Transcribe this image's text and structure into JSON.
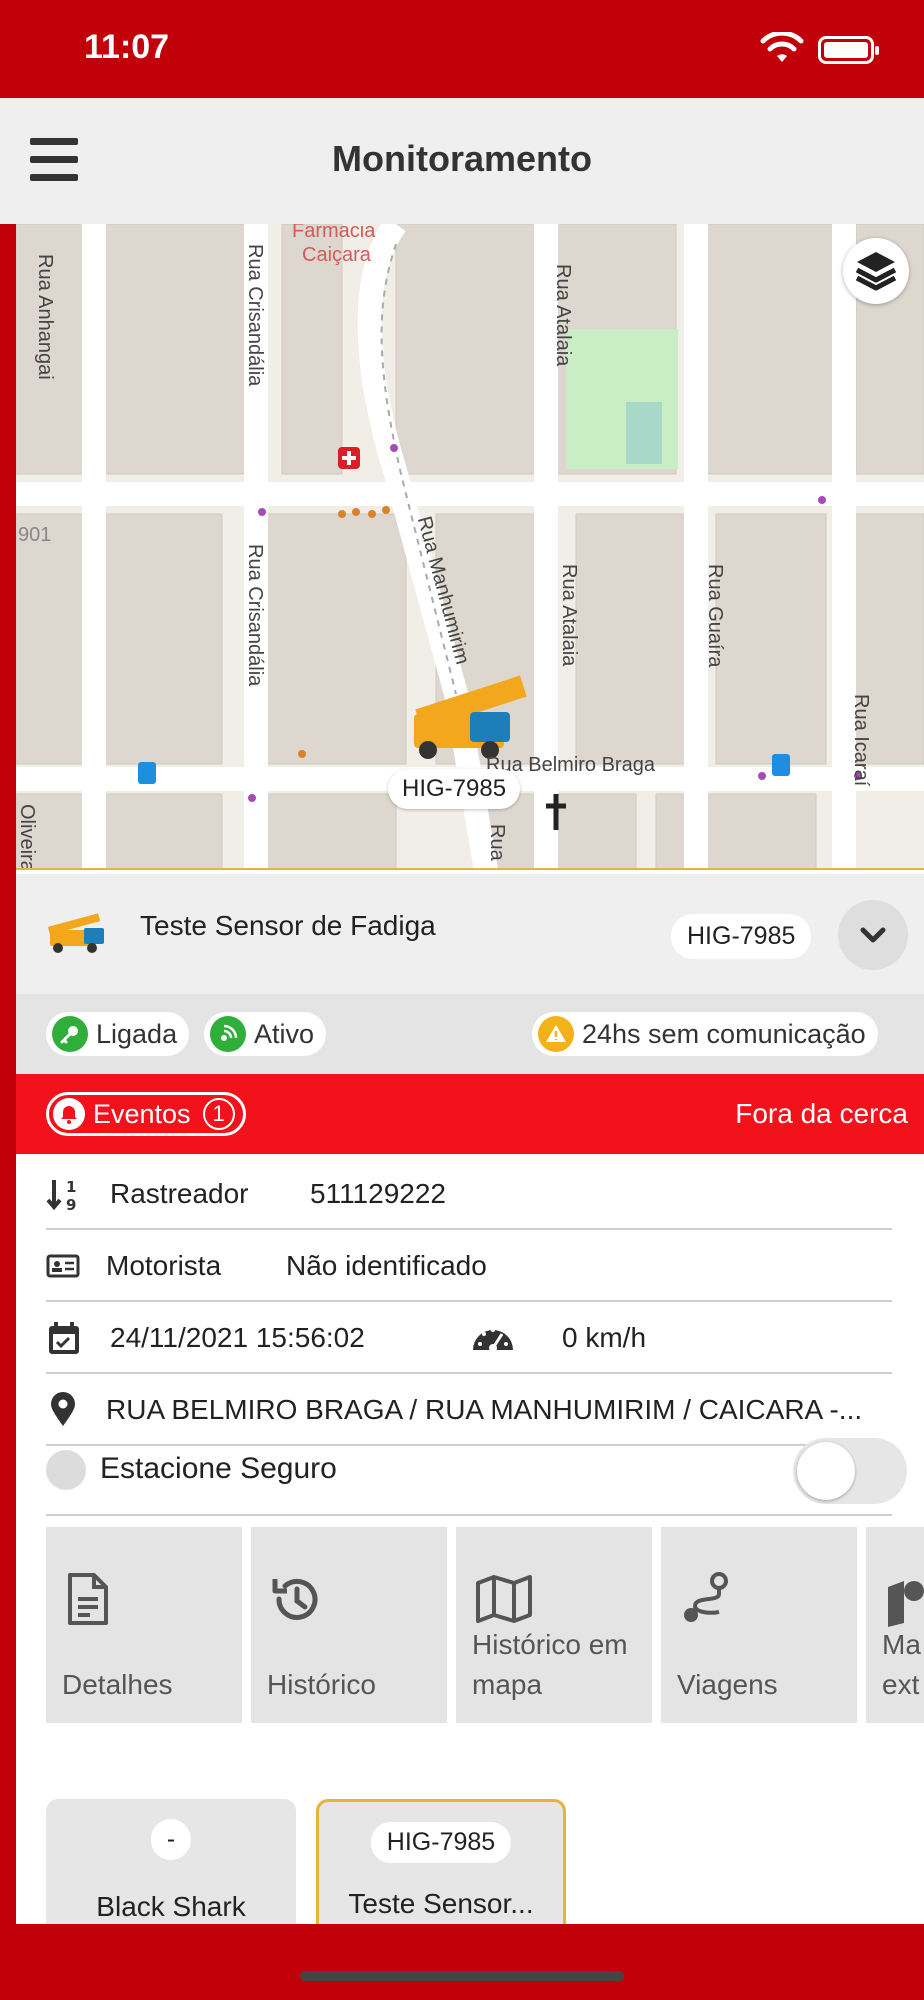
{
  "status_bar": {
    "time": "11:07"
  },
  "header": {
    "title": "Monitoramento"
  },
  "map": {
    "street_labels": [
      "Rua Anhangai",
      "Rua Crisandália",
      "Rua Crisandália",
      "Rua Manhumirim",
      "Rua Atalaia",
      "Rua Atalaia",
      "Rua Guaíra",
      "Rua Icaraí",
      "Rua Belmiro Braga",
      "Rua",
      "Oliveira",
      "Farmacia",
      "Caiçara",
      "901"
    ],
    "vehicle_plate_tag": "HIG-7985"
  },
  "vehicle": {
    "name": "Teste Sensor de Fadiga",
    "plate": "HIG-7985"
  },
  "status": {
    "ignition": "Ligada",
    "signal": "Ativo",
    "warning": "24hs sem comunicação"
  },
  "events": {
    "label": "Eventos",
    "count": "1",
    "fence": "Fora da cerca"
  },
  "info": {
    "tracker_label": "Rastreador",
    "tracker_value": "511129222",
    "driver_label": "Motorista",
    "driver_value": "Não identificado",
    "datetime": "24/11/2021 15:56:02",
    "speed": "0 km/h",
    "address": "RUA BELMIRO BRAGA / RUA MANHUMIRIM / CAICARA -..."
  },
  "safe_parking": {
    "label": "Estacione Seguro",
    "enabled": false
  },
  "actions": [
    {
      "label": "Detalhes"
    },
    {
      "label": "Histórico"
    },
    {
      "label": "Histórico em mapa"
    },
    {
      "label": "Viagens"
    },
    {
      "label": "Ma ext"
    }
  ],
  "vehicle_cards": [
    {
      "plate": "-",
      "name": "Black Shark"
    },
    {
      "plate": "HIG-7985",
      "name": "Teste Sensor..."
    }
  ],
  "colors": {
    "brand_red": "#c1000a",
    "event_red": "#f3121c",
    "accent_yellow": "#e4b43b"
  }
}
